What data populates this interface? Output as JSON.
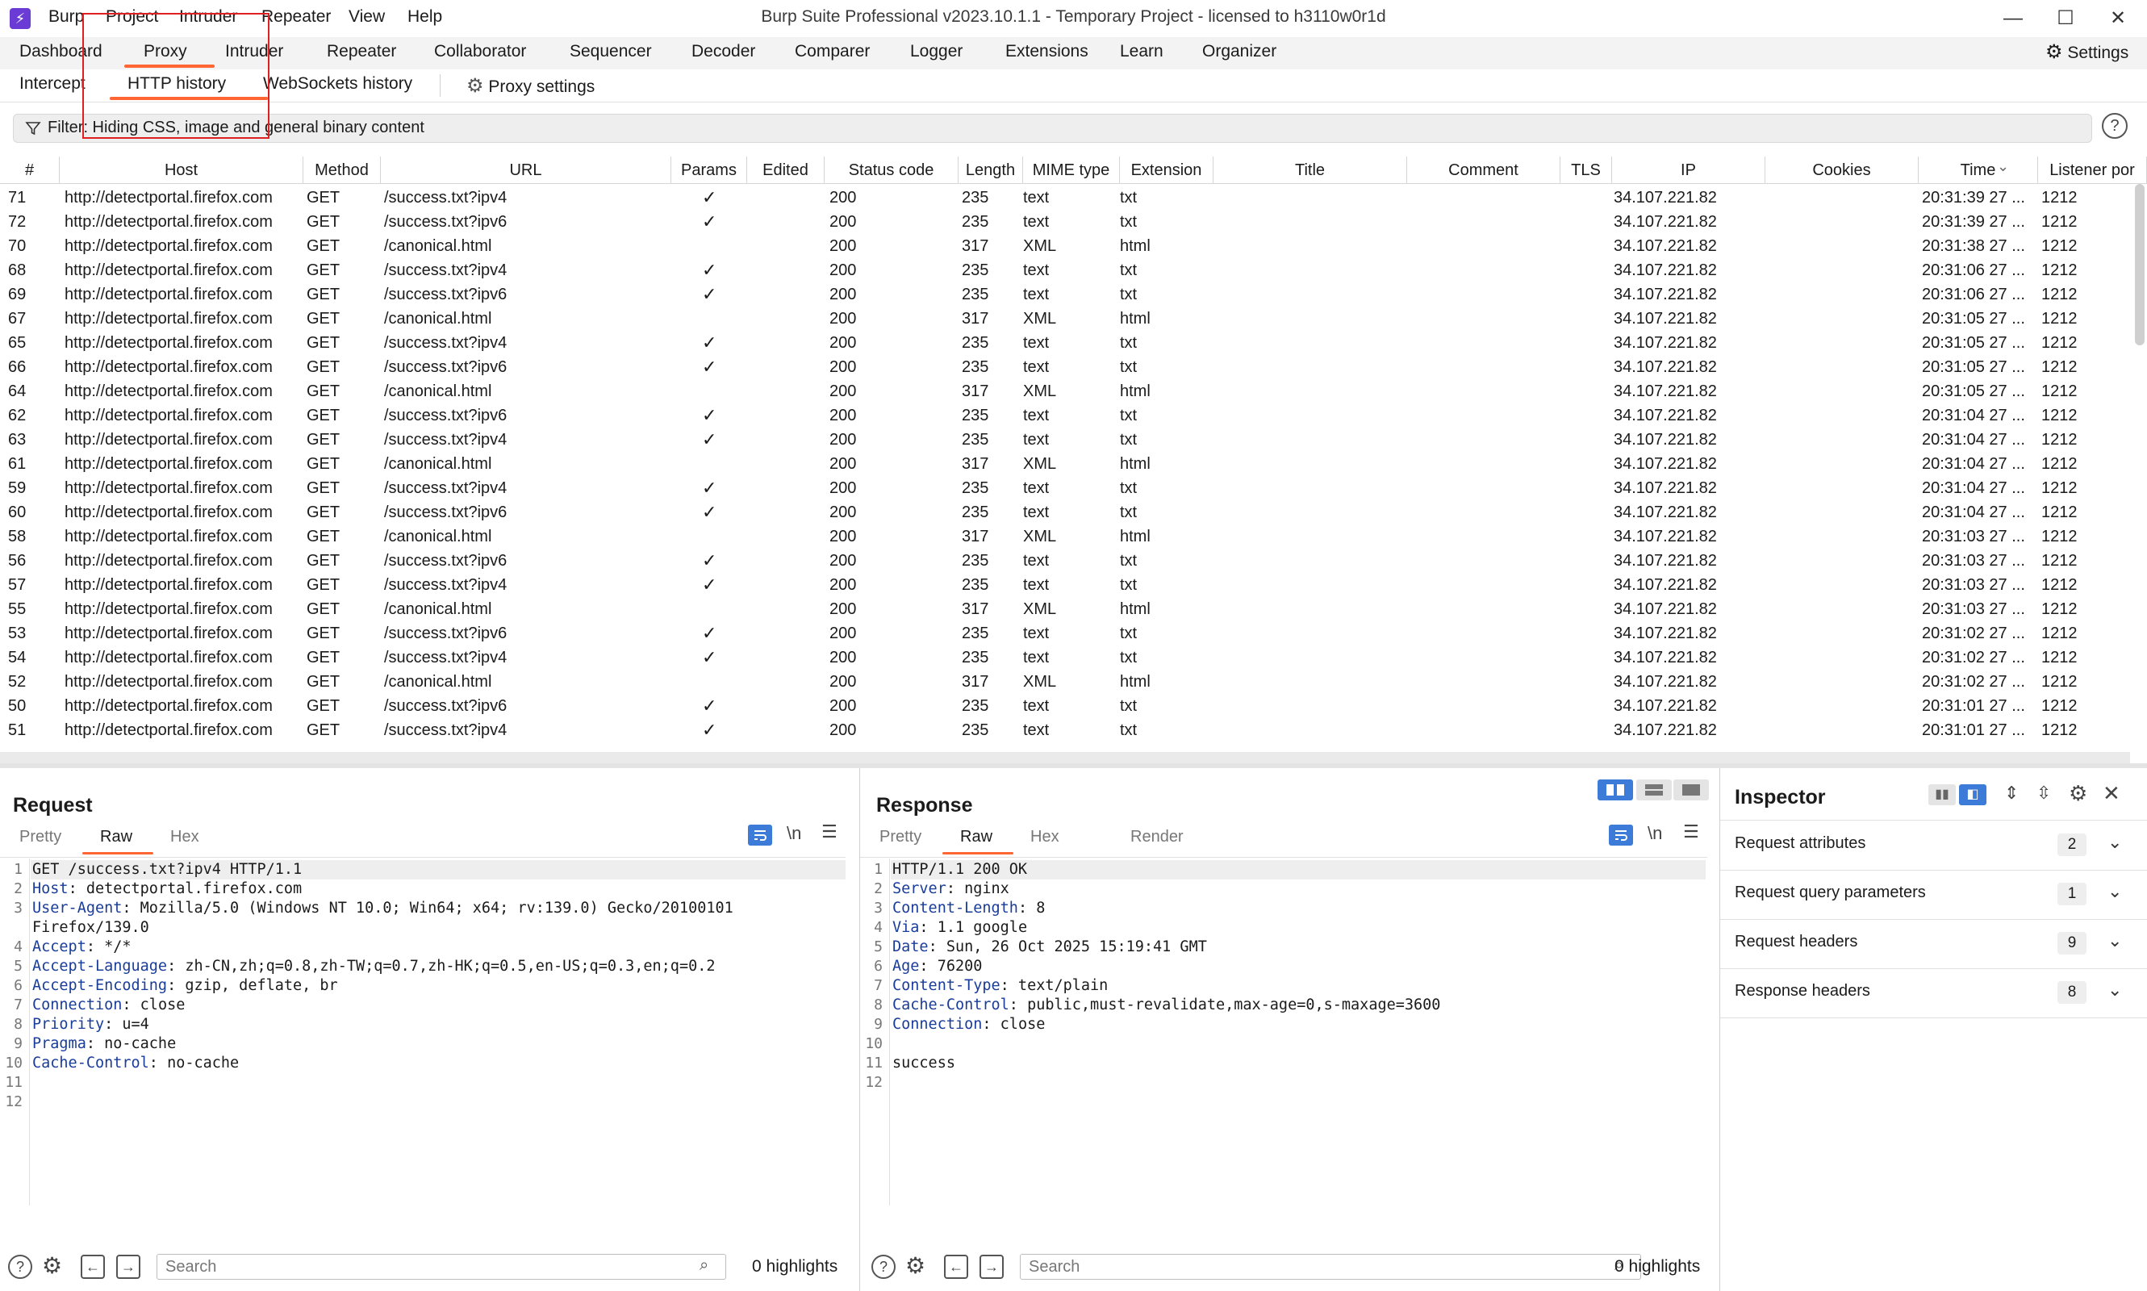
{
  "window": {
    "title": "Burp Suite Professional v2023.10.1.1 - Temporary Project - licensed to h3110w0r1d",
    "menu": [
      "Burp",
      "Project",
      "Intruder",
      "Repeater",
      "View",
      "Help"
    ],
    "controls": {
      "minimize": "—",
      "maximize": "☐",
      "close": "✕"
    }
  },
  "main_tabs": [
    "Dashboard",
    "Proxy",
    "Intruder",
    "Repeater",
    "Collaborator",
    "Sequencer",
    "Decoder",
    "Comparer",
    "Logger",
    "Extensions",
    "Learn",
    "Organizer"
  ],
  "main_tabs_active": "Proxy",
  "settings_label": "Settings",
  "sub_tabs": [
    "Intercept",
    "HTTP history",
    "WebSockets history"
  ],
  "sub_tabs_active": "HTTP history",
  "proxy_settings_label": "Proxy settings",
  "filter": {
    "text": "Filter: Hiding CSS, image and general binary content",
    "help": "?"
  },
  "table": {
    "columns": [
      "#",
      "Host",
      "Method",
      "URL",
      "Params",
      "Edited",
      "Status code",
      "Length",
      "MIME type",
      "Extension",
      "Title",
      "Comment",
      "TLS",
      "IP",
      "Cookies",
      "Time",
      "Listener por"
    ],
    "sort_indicator": "⌄",
    "check": "✓",
    "rows": [
      {
        "num": "71",
        "host": "http://detectportal.firefox.com",
        "method": "GET",
        "url": "/success.txt?ipv4",
        "params": true,
        "status": "200",
        "length": "235",
        "mime": "text",
        "ext": "txt",
        "ip": "34.107.221.82",
        "time": "20:31:39 27 ...",
        "port": "1212"
      },
      {
        "num": "72",
        "host": "http://detectportal.firefox.com",
        "method": "GET",
        "url": "/success.txt?ipv6",
        "params": true,
        "status": "200",
        "length": "235",
        "mime": "text",
        "ext": "txt",
        "ip": "34.107.221.82",
        "time": "20:31:39 27 ...",
        "port": "1212"
      },
      {
        "num": "70",
        "host": "http://detectportal.firefox.com",
        "method": "GET",
        "url": "/canonical.html",
        "params": false,
        "status": "200",
        "length": "317",
        "mime": "XML",
        "ext": "html",
        "ip": "34.107.221.82",
        "time": "20:31:38 27 ...",
        "port": "1212"
      },
      {
        "num": "68",
        "host": "http://detectportal.firefox.com",
        "method": "GET",
        "url": "/success.txt?ipv4",
        "params": true,
        "status": "200",
        "length": "235",
        "mime": "text",
        "ext": "txt",
        "ip": "34.107.221.82",
        "time": "20:31:06 27 ...",
        "port": "1212"
      },
      {
        "num": "69",
        "host": "http://detectportal.firefox.com",
        "method": "GET",
        "url": "/success.txt?ipv6",
        "params": true,
        "status": "200",
        "length": "235",
        "mime": "text",
        "ext": "txt",
        "ip": "34.107.221.82",
        "time": "20:31:06 27 ...",
        "port": "1212"
      },
      {
        "num": "67",
        "host": "http://detectportal.firefox.com",
        "method": "GET",
        "url": "/canonical.html",
        "params": false,
        "status": "200",
        "length": "317",
        "mime": "XML",
        "ext": "html",
        "ip": "34.107.221.82",
        "time": "20:31:05 27 ...",
        "port": "1212"
      },
      {
        "num": "65",
        "host": "http://detectportal.firefox.com",
        "method": "GET",
        "url": "/success.txt?ipv4",
        "params": true,
        "status": "200",
        "length": "235",
        "mime": "text",
        "ext": "txt",
        "ip": "34.107.221.82",
        "time": "20:31:05 27 ...",
        "port": "1212"
      },
      {
        "num": "66",
        "host": "http://detectportal.firefox.com",
        "method": "GET",
        "url": "/success.txt?ipv6",
        "params": true,
        "status": "200",
        "length": "235",
        "mime": "text",
        "ext": "txt",
        "ip": "34.107.221.82",
        "time": "20:31:05 27 ...",
        "port": "1212"
      },
      {
        "num": "64",
        "host": "http://detectportal.firefox.com",
        "method": "GET",
        "url": "/canonical.html",
        "params": false,
        "status": "200",
        "length": "317",
        "mime": "XML",
        "ext": "html",
        "ip": "34.107.221.82",
        "time": "20:31:05 27 ...",
        "port": "1212"
      },
      {
        "num": "62",
        "host": "http://detectportal.firefox.com",
        "method": "GET",
        "url": "/success.txt?ipv6",
        "params": true,
        "status": "200",
        "length": "235",
        "mime": "text",
        "ext": "txt",
        "ip": "34.107.221.82",
        "time": "20:31:04 27 ...",
        "port": "1212"
      },
      {
        "num": "63",
        "host": "http://detectportal.firefox.com",
        "method": "GET",
        "url": "/success.txt?ipv4",
        "params": true,
        "status": "200",
        "length": "235",
        "mime": "text",
        "ext": "txt",
        "ip": "34.107.221.82",
        "time": "20:31:04 27 ...",
        "port": "1212"
      },
      {
        "num": "61",
        "host": "http://detectportal.firefox.com",
        "method": "GET",
        "url": "/canonical.html",
        "params": false,
        "status": "200",
        "length": "317",
        "mime": "XML",
        "ext": "html",
        "ip": "34.107.221.82",
        "time": "20:31:04 27 ...",
        "port": "1212"
      },
      {
        "num": "59",
        "host": "http://detectportal.firefox.com",
        "method": "GET",
        "url": "/success.txt?ipv4",
        "params": true,
        "status": "200",
        "length": "235",
        "mime": "text",
        "ext": "txt",
        "ip": "34.107.221.82",
        "time": "20:31:04 27 ...",
        "port": "1212"
      },
      {
        "num": "60",
        "host": "http://detectportal.firefox.com",
        "method": "GET",
        "url": "/success.txt?ipv6",
        "params": true,
        "status": "200",
        "length": "235",
        "mime": "text",
        "ext": "txt",
        "ip": "34.107.221.82",
        "time": "20:31:04 27 ...",
        "port": "1212"
      },
      {
        "num": "58",
        "host": "http://detectportal.firefox.com",
        "method": "GET",
        "url": "/canonical.html",
        "params": false,
        "status": "200",
        "length": "317",
        "mime": "XML",
        "ext": "html",
        "ip": "34.107.221.82",
        "time": "20:31:03 27 ...",
        "port": "1212"
      },
      {
        "num": "56",
        "host": "http://detectportal.firefox.com",
        "method": "GET",
        "url": "/success.txt?ipv6",
        "params": true,
        "status": "200",
        "length": "235",
        "mime": "text",
        "ext": "txt",
        "ip": "34.107.221.82",
        "time": "20:31:03 27 ...",
        "port": "1212"
      },
      {
        "num": "57",
        "host": "http://detectportal.firefox.com",
        "method": "GET",
        "url": "/success.txt?ipv4",
        "params": true,
        "status": "200",
        "length": "235",
        "mime": "text",
        "ext": "txt",
        "ip": "34.107.221.82",
        "time": "20:31:03 27 ...",
        "port": "1212"
      },
      {
        "num": "55",
        "host": "http://detectportal.firefox.com",
        "method": "GET",
        "url": "/canonical.html",
        "params": false,
        "status": "200",
        "length": "317",
        "mime": "XML",
        "ext": "html",
        "ip": "34.107.221.82",
        "time": "20:31:03 27 ...",
        "port": "1212"
      },
      {
        "num": "53",
        "host": "http://detectportal.firefox.com",
        "method": "GET",
        "url": "/success.txt?ipv6",
        "params": true,
        "status": "200",
        "length": "235",
        "mime": "text",
        "ext": "txt",
        "ip": "34.107.221.82",
        "time": "20:31:02 27 ...",
        "port": "1212"
      },
      {
        "num": "54",
        "host": "http://detectportal.firefox.com",
        "method": "GET",
        "url": "/success.txt?ipv4",
        "params": true,
        "status": "200",
        "length": "235",
        "mime": "text",
        "ext": "txt",
        "ip": "34.107.221.82",
        "time": "20:31:02 27 ...",
        "port": "1212"
      },
      {
        "num": "52",
        "host": "http://detectportal.firefox.com",
        "method": "GET",
        "url": "/canonical.html",
        "params": false,
        "status": "200",
        "length": "317",
        "mime": "XML",
        "ext": "html",
        "ip": "34.107.221.82",
        "time": "20:31:02 27 ...",
        "port": "1212"
      },
      {
        "num": "50",
        "host": "http://detectportal.firefox.com",
        "method": "GET",
        "url": "/success.txt?ipv6",
        "params": true,
        "status": "200",
        "length": "235",
        "mime": "text",
        "ext": "txt",
        "ip": "34.107.221.82",
        "time": "20:31:01 27 ...",
        "port": "1212"
      },
      {
        "num": "51",
        "host": "http://detectportal.firefox.com",
        "method": "GET",
        "url": "/success.txt?ipv4",
        "params": true,
        "status": "200",
        "length": "235",
        "mime": "text",
        "ext": "txt",
        "ip": "34.107.221.82",
        "time": "20:31:01 27 ...",
        "port": "1212"
      }
    ]
  },
  "request": {
    "title": "Request",
    "tabs": [
      "Pretty",
      "Raw",
      "Hex"
    ],
    "active_tab": "Raw",
    "wrap_label": "\\n",
    "lines": [
      {
        "n": "1",
        "name": "",
        "text": "GET /success.txt?ipv4 HTTP/1.1"
      },
      {
        "n": "2",
        "name": "Host",
        "text": ": detectportal.firefox.com"
      },
      {
        "n": "3",
        "name": "User-Agent",
        "text": ": Mozilla/5.0 (Windows NT 10.0; Win64; x64; rv:139.0) Gecko/20100101"
      },
      {
        "n": "",
        "name": "",
        "text": "Firefox/139.0"
      },
      {
        "n": "4",
        "name": "Accept",
        "text": ": */*"
      },
      {
        "n": "5",
        "name": "Accept-Language",
        "text": ": zh-CN,zh;q=0.8,zh-TW;q=0.7,zh-HK;q=0.5,en-US;q=0.3,en;q=0.2"
      },
      {
        "n": "6",
        "name": "Accept-Encoding",
        "text": ": gzip, deflate, br"
      },
      {
        "n": "7",
        "name": "Connection",
        "text": ": close"
      },
      {
        "n": "8",
        "name": "Priority",
        "text": ": u=4"
      },
      {
        "n": "9",
        "name": "Pragma",
        "text": ": no-cache"
      },
      {
        "n": "10",
        "name": "Cache-Control",
        "text": ": no-cache"
      },
      {
        "n": "11",
        "name": "",
        "text": ""
      },
      {
        "n": "12",
        "name": "",
        "text": ""
      }
    ],
    "search_placeholder": "Search",
    "highlights": "0 highlights"
  },
  "response": {
    "title": "Response",
    "tabs": [
      "Pretty",
      "Raw",
      "Hex",
      "Render"
    ],
    "active_tab": "Raw",
    "wrap_label": "\\n",
    "lines": [
      {
        "n": "1",
        "name": "",
        "text": "HTTP/1.1 200 OK"
      },
      {
        "n": "2",
        "name": "Server",
        "text": ": nginx"
      },
      {
        "n": "3",
        "name": "Content-Length",
        "text": ": 8"
      },
      {
        "n": "4",
        "name": "Via",
        "text": ": 1.1 google"
      },
      {
        "n": "5",
        "name": "Date",
        "text": ": Sun, 26 Oct 2025 15:19:41 GMT"
      },
      {
        "n": "6",
        "name": "Age",
        "text": ": 76200"
      },
      {
        "n": "7",
        "name": "Content-Type",
        "text": ": text/plain"
      },
      {
        "n": "8",
        "name": "Cache-Control",
        "text": ": public,must-revalidate,max-age=0,s-maxage=3600"
      },
      {
        "n": "9",
        "name": "Connection",
        "text": ": close"
      },
      {
        "n": "10",
        "name": "",
        "text": ""
      },
      {
        "n": "11",
        "name": "",
        "text": "success"
      },
      {
        "n": "12",
        "name": "",
        "text": ""
      }
    ],
    "search_placeholder": "Search",
    "highlights": "0 highlights"
  },
  "inspector": {
    "title": "Inspector",
    "sections": [
      {
        "label": "Request attributes",
        "count": "2"
      },
      {
        "label": "Request query parameters",
        "count": "1"
      },
      {
        "label": "Request headers",
        "count": "9"
      },
      {
        "label": "Response headers",
        "count": "8"
      }
    ]
  },
  "colors": {
    "accent": "#ff6633",
    "blue": "#3d7bd9",
    "highlight_box": "#e02020",
    "header_name": "#1a3d9a"
  }
}
